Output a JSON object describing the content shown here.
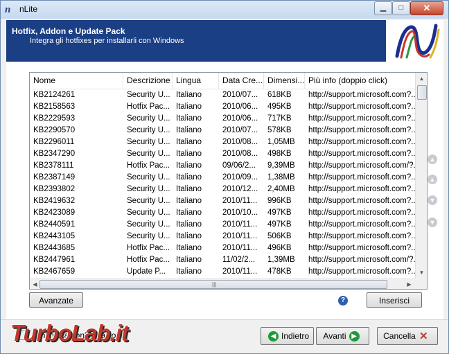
{
  "window": {
    "title": "nLite",
    "app_icon": "n"
  },
  "header": {
    "title": "Hotfix, Addon e Update Pack",
    "subtitle": "Integra gli hotfixes per installarli con Windows"
  },
  "table": {
    "columns": [
      "Nome",
      "Descrizione",
      "Lingua",
      "Data Cre...",
      "Dimensi...",
      "Più info (doppio click)"
    ],
    "rows": [
      [
        "KB2124261",
        "Security U...",
        "Italiano",
        "2010/07...",
        "618KB",
        "http://support.microsoft.com?..."
      ],
      [
        "KB2158563",
        "Hotfix Pac...",
        "Italiano",
        "2010/06...",
        "495KB",
        "http://support.microsoft.com?..."
      ],
      [
        "KB2229593",
        "Security U...",
        "Italiano",
        "2010/06...",
        "717KB",
        "http://support.microsoft.com?..."
      ],
      [
        "KB2290570",
        "Security U...",
        "Italiano",
        "2010/07...",
        "578KB",
        "http://support.microsoft.com?..."
      ],
      [
        "KB2296011",
        "Security U...",
        "Italiano",
        "2010/08...",
        "1,05MB",
        "http://support.microsoft.com?..."
      ],
      [
        "KB2347290",
        "Security U...",
        "Italiano",
        "2010/08...",
        "498KB",
        "http://support.microsoft.com?..."
      ],
      [
        "KB2378111",
        "Hotfix Pac...",
        "Italiano",
        "09/06/2...",
        "9,39MB",
        "http://support.microsoft.com/?..."
      ],
      [
        "KB2387149",
        "Security U...",
        "Italiano",
        "2010/09...",
        "1,38MB",
        "http://support.microsoft.com?..."
      ],
      [
        "KB2393802",
        "Security U...",
        "Italiano",
        "2010/12...",
        "2,40MB",
        "http://support.microsoft.com?..."
      ],
      [
        "KB2419632",
        "Security U...",
        "Italiano",
        "2010/11...",
        "996KB",
        "http://support.microsoft.com?..."
      ],
      [
        "KB2423089",
        "Security U...",
        "Italiano",
        "2010/10...",
        "497KB",
        "http://support.microsoft.com?..."
      ],
      [
        "KB2440591",
        "Security U...",
        "Italiano",
        "2010/11...",
        "497KB",
        "http://support.microsoft.com?..."
      ],
      [
        "KB2443105",
        "Security U...",
        "Italiano",
        "2010/11...",
        "506KB",
        "http://support.microsoft.com?..."
      ],
      [
        "KB2443685",
        "Hotfix Pac...",
        "Italiano",
        "2010/11...",
        "496KB",
        "http://support.microsoft.com?..."
      ],
      [
        "KB2447961",
        "Hotfix Pac...",
        "Italiano",
        "11/02/2...",
        "1,39MB",
        "http://support.microsoft.com/?..."
      ],
      [
        "KB2467659",
        "Update P...",
        "Italiano",
        "2010/11...",
        "478KB",
        "http://support.microsoft.com?..."
      ]
    ]
  },
  "buttons": {
    "avanzate": "Avanzate",
    "inserisci": "Inserisci",
    "indietro": "Indietro",
    "avanti": "Avanti",
    "cancella": "Cancella"
  },
  "footer": {
    "minimize_label": "Minimizza configurazione",
    "watermark": "TurboLab.it"
  },
  "icons": {
    "help": "?",
    "up": "▲",
    "down": "▼",
    "left": "◀",
    "right": "▶",
    "grip": "|||"
  },
  "colors": {
    "header_bg": "#1b3f85",
    "accent_green": "#1f9a3a",
    "close_red": "#c0392b"
  }
}
